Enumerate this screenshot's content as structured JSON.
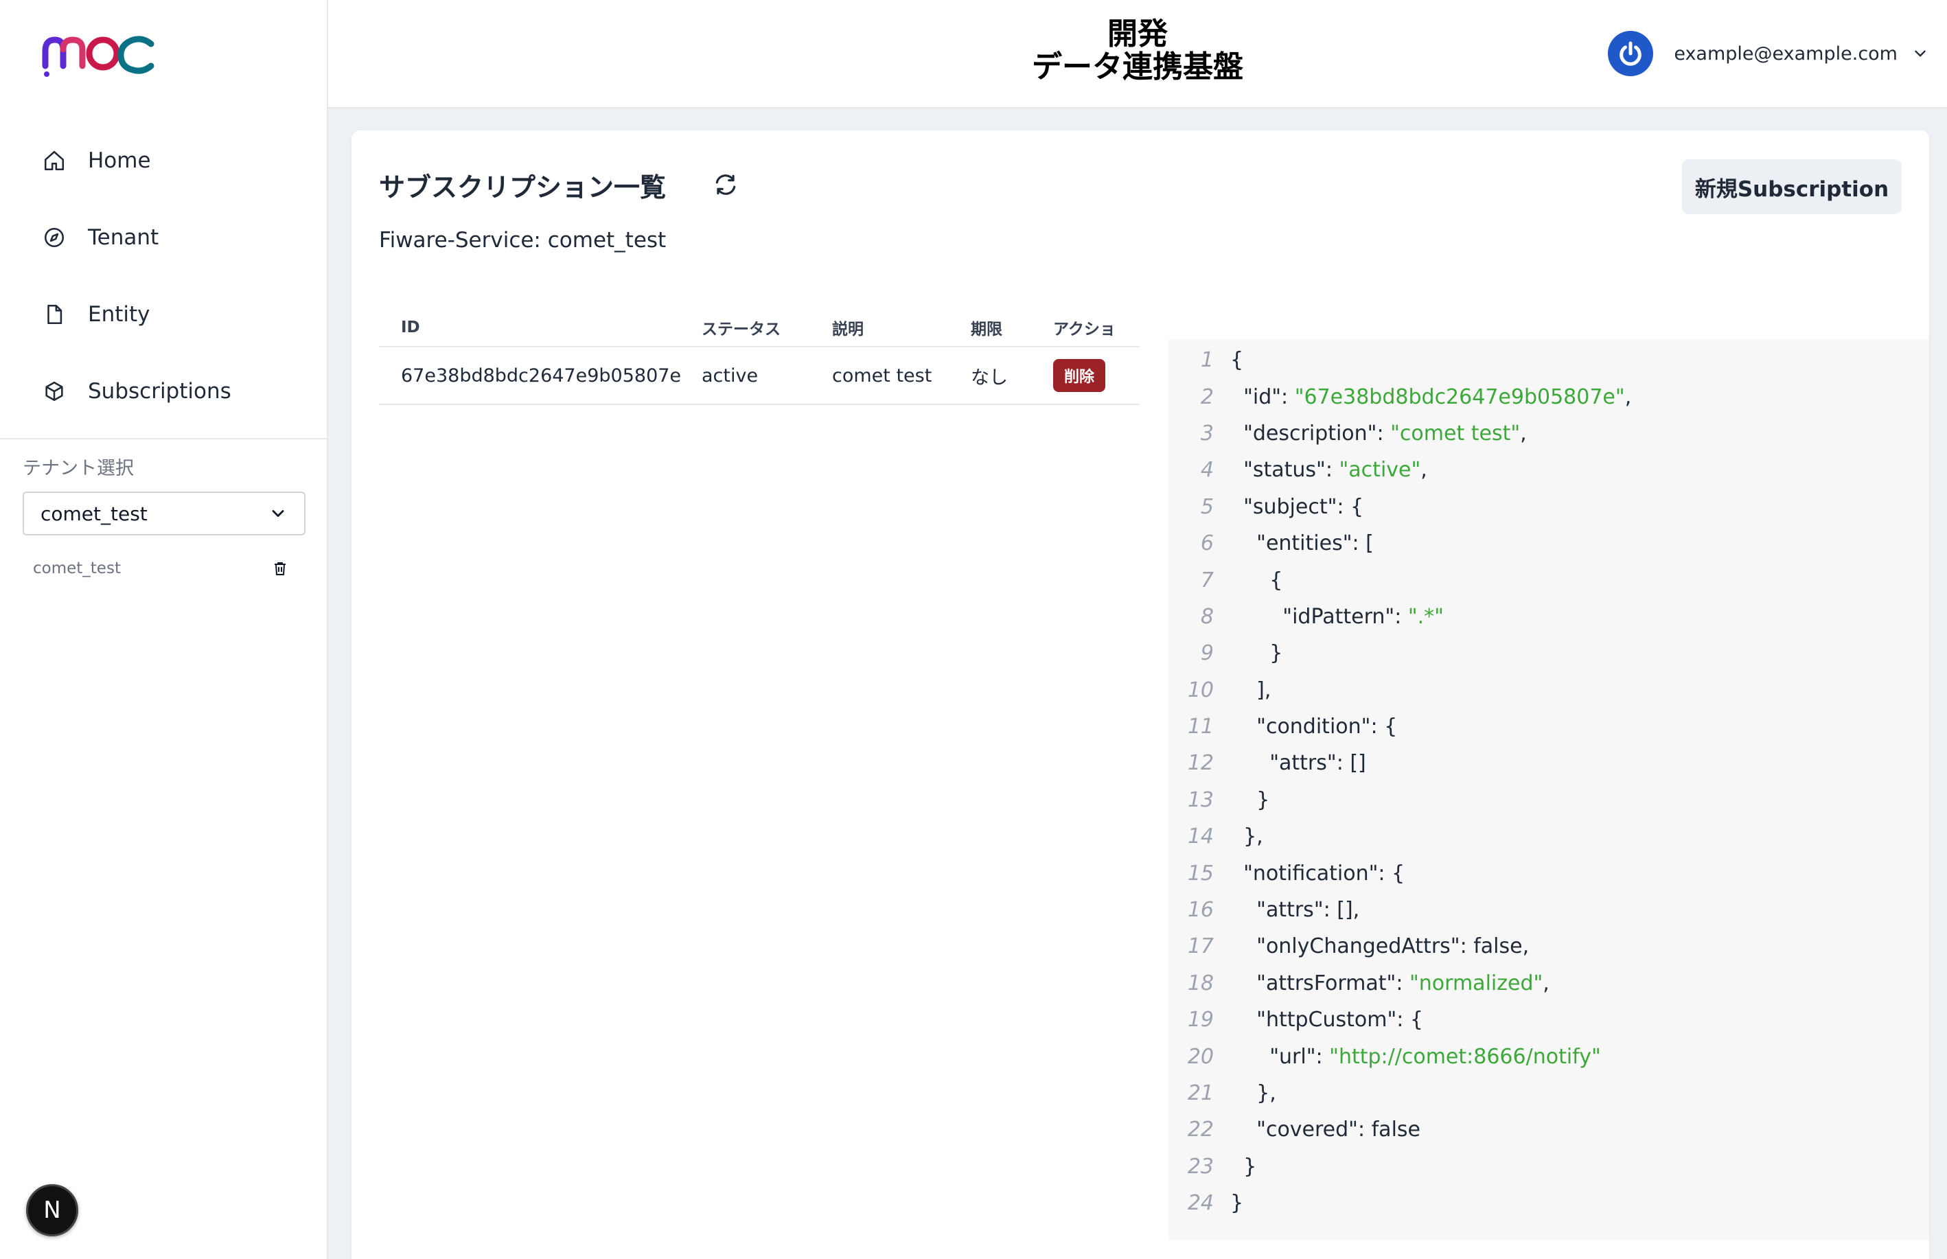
{
  "sidebar": {
    "logo_alt": "moc",
    "nav": [
      {
        "label": "Home",
        "icon": "home-icon"
      },
      {
        "label": "Tenant",
        "icon": "compass-icon"
      },
      {
        "label": "Entity",
        "icon": "document-icon"
      },
      {
        "label": "Subscriptions",
        "icon": "cube-icon"
      }
    ],
    "tenant_label": "テナント選択",
    "tenant_selected": "comet_test",
    "tenants": [
      {
        "name": "comet_test"
      }
    ],
    "next_badge": "N"
  },
  "header": {
    "title_line1": "開発",
    "title_line2": "データ連携基盤",
    "user_email": "example@example.com",
    "colors": {
      "avatar": "#1f58c8"
    }
  },
  "main": {
    "title": "サブスクリプション一覧",
    "service_line": "Fiware-Service: comet_test",
    "new_button": "新規Subscription",
    "table": {
      "headers": [
        "ID",
        "ステータス",
        "説明",
        "期限",
        "アクショ"
      ],
      "rows": [
        {
          "id": "67e38bd8bdc2647e9b05807e",
          "status": "active",
          "description": "comet test",
          "expiry": "なし",
          "action": "削除"
        }
      ]
    },
    "code": [
      {
        "n": "1",
        "parts": [
          {
            "t": "{"
          }
        ]
      },
      {
        "n": "2",
        "parts": [
          {
            "t": "  \"id\": "
          },
          {
            "t": "\"67e38bd8bdc2647e9b05807e\"",
            "s": true
          },
          {
            "t": ","
          }
        ]
      },
      {
        "n": "3",
        "parts": [
          {
            "t": "  \"description\": "
          },
          {
            "t": "\"comet test\"",
            "s": true
          },
          {
            "t": ","
          }
        ]
      },
      {
        "n": "4",
        "parts": [
          {
            "t": "  \"status\": "
          },
          {
            "t": "\"active\"",
            "s": true
          },
          {
            "t": ","
          }
        ]
      },
      {
        "n": "5",
        "parts": [
          {
            "t": "  \"subject\": {"
          }
        ]
      },
      {
        "n": "6",
        "parts": [
          {
            "t": "    \"entities\": ["
          }
        ]
      },
      {
        "n": "7",
        "parts": [
          {
            "t": "      {"
          }
        ]
      },
      {
        "n": "8",
        "parts": [
          {
            "t": "        \"idPattern\": "
          },
          {
            "t": "\".*\"",
            "s": true
          }
        ]
      },
      {
        "n": "9",
        "parts": [
          {
            "t": "      }"
          }
        ]
      },
      {
        "n": "10",
        "parts": [
          {
            "t": "    ],"
          }
        ]
      },
      {
        "n": "11",
        "parts": [
          {
            "t": "    \"condition\": {"
          }
        ]
      },
      {
        "n": "12",
        "parts": [
          {
            "t": "      \"attrs\": []"
          }
        ]
      },
      {
        "n": "13",
        "parts": [
          {
            "t": "    }"
          }
        ]
      },
      {
        "n": "14",
        "parts": [
          {
            "t": "  },"
          }
        ]
      },
      {
        "n": "15",
        "parts": [
          {
            "t": "  \"notification\": {"
          }
        ]
      },
      {
        "n": "16",
        "parts": [
          {
            "t": "    \"attrs\": [],"
          }
        ]
      },
      {
        "n": "17",
        "parts": [
          {
            "t": "    \"onlyChangedAttrs\": false,"
          }
        ]
      },
      {
        "n": "18",
        "parts": [
          {
            "t": "    \"attrsFormat\": "
          },
          {
            "t": "\"normalized\"",
            "s": true
          },
          {
            "t": ","
          }
        ]
      },
      {
        "n": "19",
        "parts": [
          {
            "t": "    \"httpCustom\": {"
          }
        ]
      },
      {
        "n": "20",
        "parts": [
          {
            "t": "      \"url\": "
          },
          {
            "t": "\"http://comet:8666/notify\"",
            "s": true
          }
        ]
      },
      {
        "n": "21",
        "parts": [
          {
            "t": "    },"
          }
        ]
      },
      {
        "n": "22",
        "parts": [
          {
            "t": "    \"covered\": false"
          }
        ]
      },
      {
        "n": "23",
        "parts": [
          {
            "t": "  }"
          }
        ]
      },
      {
        "n": "24",
        "parts": [
          {
            "t": "}"
          }
        ]
      }
    ],
    "colors": {
      "string": "#3da83a",
      "delete": "#9b2226"
    }
  }
}
